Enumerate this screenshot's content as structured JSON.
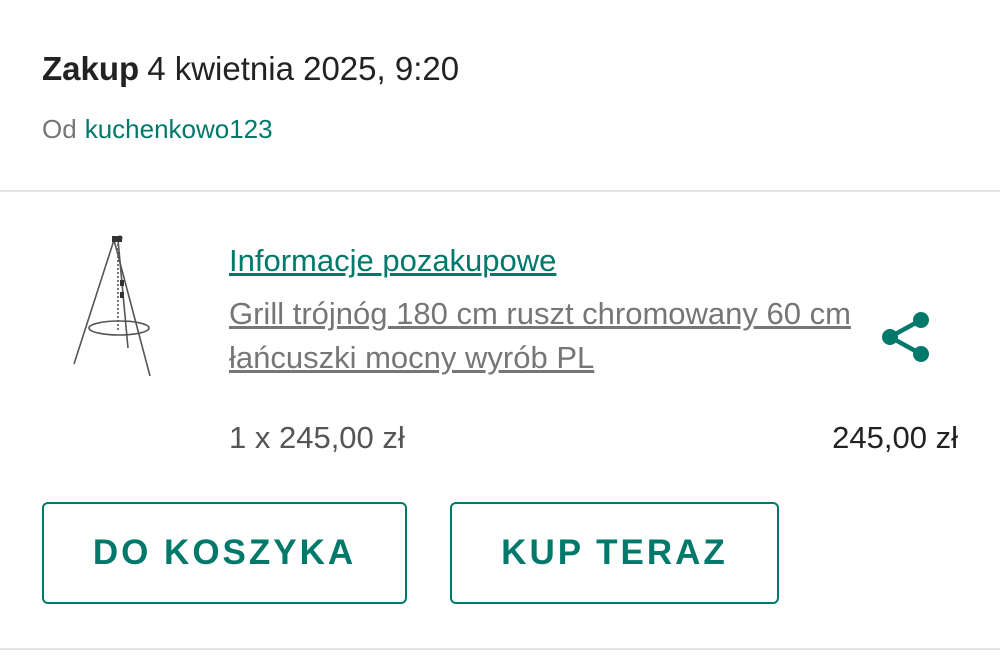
{
  "purchase": {
    "title": "Zakup",
    "date": "4 kwietnia 2025, 9:20",
    "seller_prefix": "Od",
    "seller_name": "kuchenkowo123"
  },
  "item": {
    "info_link": "Informacje pozakupowe",
    "name": "Grill trójnóg 180 cm ruszt chromowany 60 cm łańcuszki mocny wyrób PL",
    "quantity_line": "1 x 245,00 zł",
    "total": "245,00 zł",
    "thumbnail_icon": "tripod-grill-image",
    "share_icon": "share-icon"
  },
  "actions": {
    "add_to_cart": "DO KOSZYKA",
    "buy_now": "KUP TERAZ"
  },
  "colors": {
    "accent": "#00796b",
    "text_dark": "#222222",
    "text_muted": "#767676",
    "divider": "#e2e2e2"
  }
}
